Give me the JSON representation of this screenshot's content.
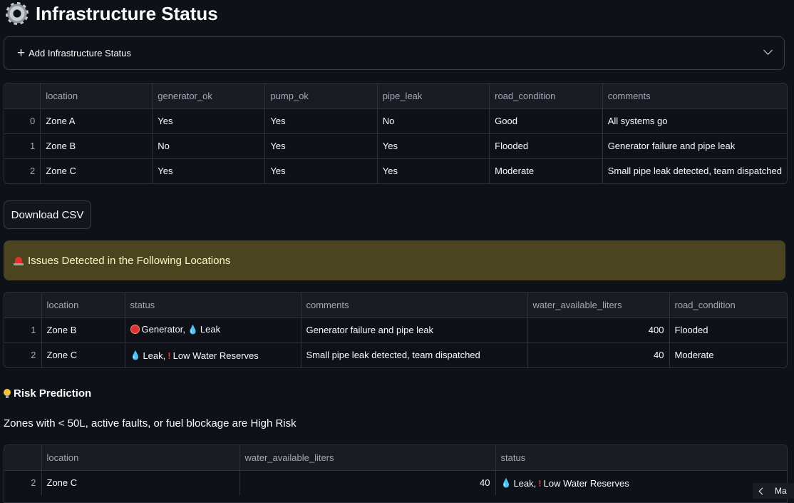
{
  "page_title": "Infrastructure Status",
  "expander": {
    "label": "Add Infrastructure Status"
  },
  "table1": {
    "columns": [
      "",
      "location",
      "generator_ok",
      "pump_ok",
      "pipe_leak",
      "road_condition",
      "comments"
    ],
    "rows": [
      [
        "0",
        "Zone A",
        "Yes",
        "Yes",
        "No",
        "Good",
        "All systems go"
      ],
      [
        "1",
        "Zone B",
        "No",
        "Yes",
        "Yes",
        "Flooded",
        "Generator failure and pipe leak"
      ],
      [
        "2",
        "Zone C",
        "Yes",
        "Yes",
        "Yes",
        "Moderate",
        "Small pipe leak detected, team dispatched"
      ]
    ]
  },
  "download_button": "Download CSV",
  "alert": {
    "text": "Issues Detected in the Following Locations"
  },
  "table2": {
    "columns": [
      "",
      "location",
      "status",
      "comments",
      "water_available_liters",
      "road_condition"
    ],
    "rows": [
      {
        "idx": "1",
        "location": "Zone B",
        "status": {
          "p1": "Generator,",
          "p2": "Leak"
        },
        "comments": "Generator failure and pipe leak",
        "water": "400",
        "road": "Flooded"
      },
      {
        "idx": "2",
        "location": "Zone C",
        "status": {
          "p1": "Leak,",
          "p2": "Low Water Reserves"
        },
        "comments": "Small pipe leak detected, team dispatched",
        "water": "40",
        "road": "Moderate"
      }
    ]
  },
  "risk": {
    "heading": "Risk Prediction",
    "caption": "Zones with < 50L, active faults, or fuel blockage are High Risk"
  },
  "table3": {
    "columns": [
      "",
      "location",
      "water_available_liters",
      "status"
    ],
    "rows": [
      {
        "idx": "2",
        "location": "Zone C",
        "water": "40",
        "status": {
          "p1": "Leak,",
          "p2": "Low Water Reserves"
        }
      }
    ]
  },
  "nav": {
    "label": "Ma"
  }
}
